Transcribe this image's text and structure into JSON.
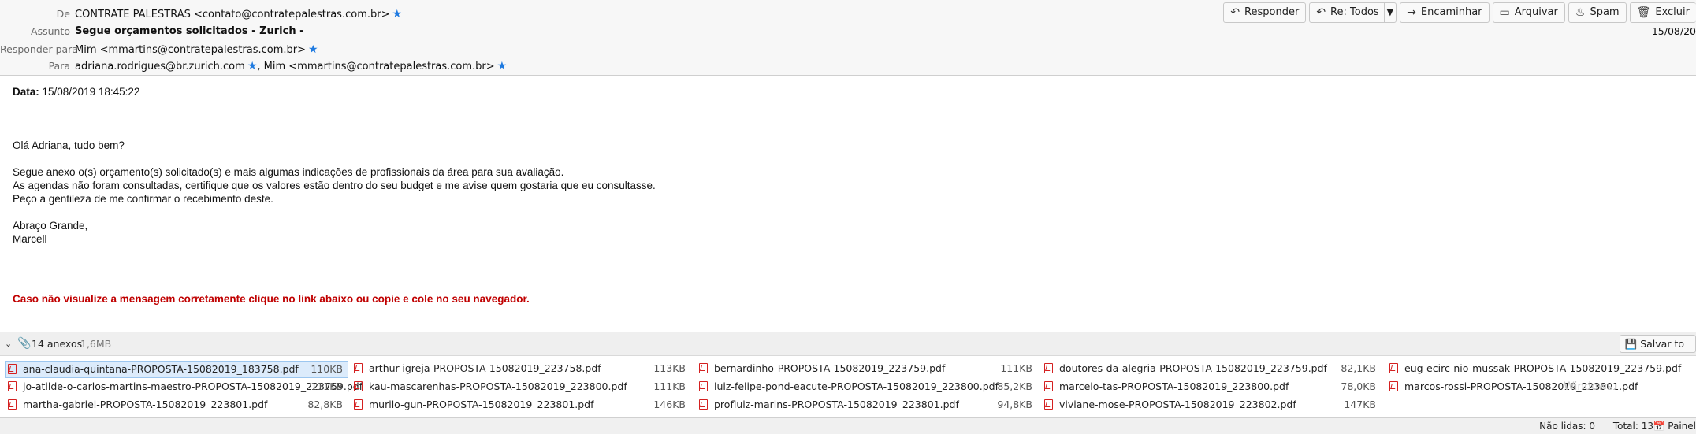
{
  "header": {
    "from_label": "De",
    "from_value": "CONTRATE PALESTRAS <contato@contratepalestras.com.br>",
    "subject_label": "Assunto",
    "subject_value": "Segue orçamentos solicitados - Zurich -",
    "replyto_label": "Responder para",
    "replyto_value": "Mim <mmartins@contratepalestras.com.br>",
    "to_label": "Para",
    "to_value_1": "adriana.rodrigues@br.zurich.com",
    "to_value_sep": ", ",
    "to_value_2": "Mim <mmartins@contratepalestras.com.br>",
    "date": "15/08/20",
    "star_icon": "★"
  },
  "toolbar": {
    "reply": "Responder",
    "reply_all": "Re: Todos",
    "forward": "Encaminhar",
    "archive": "Arquivar",
    "spam": "Spam",
    "delete": "Excluir"
  },
  "body": {
    "date_label": "Data:",
    "date_value": " 15/08/2019 18:45:22",
    "greeting": "Olá Adriana, tudo bem?",
    "line1": "Segue anexo o(s) orçamento(s) solicitado(s) e mais algumas indicações de profissionais da área para sua avaliação.",
    "line2": "As agendas não foram consultadas, certifique que os valores estão dentro do seu budget e me avise quem gostaria que eu consultasse.",
    "line3": "Peço a gentileza de me confirmar o recebimento deste.",
    "closing": "Abraço Grande,",
    "signature": "Marcell",
    "warning": "Caso não visualize a mensagem corretamente clique no link abaixo ou copie e cole no seu navegador."
  },
  "attachments": {
    "count_label": "14 anexos",
    "total_size": "1,6MB",
    "save_label": "Salvar to",
    "items": [
      {
        "name": "ana-claudia-quintana-PROPOSTA-15082019_183758.pdf",
        "size": "110KB"
      },
      {
        "name": "arthur-igreja-PROPOSTA-15082019_223758.pdf",
        "size": "113KB"
      },
      {
        "name": "bernardinho-PROPOSTA-15082019_223759.pdf",
        "size": "111KB"
      },
      {
        "name": "doutores-da-alegria-PROPOSTA-15082019_223759.pdf",
        "size": "82,1KB"
      },
      {
        "name": "eug-ecirc-nio-mussak-PROPOSTA-15082019_223759.pdf",
        "size": ""
      },
      {
        "name": "jo-atilde-o-carlos-martins-maestro-PROPOSTA-15082019_223759.pdf",
        "size": "111KB"
      },
      {
        "name": "kau-mascarenhas-PROPOSTA-15082019_223800.pdf",
        "size": "111KB"
      },
      {
        "name": "luiz-felipe-pond-eacute-PROPOSTA-15082019_223800.pdf",
        "size": "85,2KB"
      },
      {
        "name": "marcelo-tas-PROPOSTA-15082019_223800.pdf",
        "size": "78,0KB"
      },
      {
        "name": "marcos-rossi-PROPOSTA-15082019_223801.pdf",
        "size": ""
      },
      {
        "name": "martha-gabriel-PROPOSTA-15082019_223801.pdf",
        "size": "82,8KB"
      },
      {
        "name": "murilo-gun-PROPOSTA-15082019_223801.pdf",
        "size": "146KB"
      },
      {
        "name": "profluiz-marins-PROPOSTA-15082019_223801.pdf",
        "size": "94,8KB"
      },
      {
        "name": "viviane-mose-PROPOSTA-15082019_223802.pdf",
        "size": "147KB"
      }
    ]
  },
  "status": {
    "unread": "Não lidas: 0",
    "total": "Total: 13",
    "panel": "Painel"
  },
  "watermark": "Windows."
}
